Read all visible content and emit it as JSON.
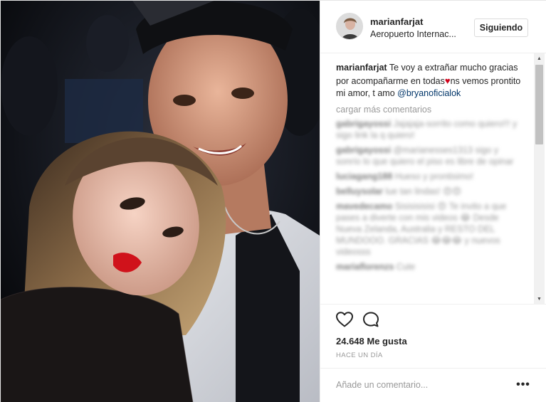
{
  "header": {
    "username": "marianfarjat",
    "location": "Aeropuerto Internac...",
    "follow_label": "Siguiendo"
  },
  "caption": {
    "user": "marianfarjat",
    "text_before": "Te voy a extrañar mucho gracias por acompañarme en todas",
    "heart": "♥",
    "text_after": "ns vemos prontito mi amor, t amo",
    "mention": "@bryanoficialok"
  },
  "load_more": "cargar más comentarios",
  "comments": [
    {
      "user": "gabrigayossi",
      "text": "Jajajaja-sorrito como quiero!!! y sigo link la q quiero!"
    },
    {
      "user": "gabrigayossi",
      "text": "@marianesses1313 sigo y sonrío lo que quiero el piso es libre de opinar"
    },
    {
      "user": "luciagang188",
      "text": "Hueso y prontisimo!"
    },
    {
      "user": "belluysolar",
      "text": "lue tan lindas! 😍😍"
    },
    {
      "user": "mavedecamo",
      "text": "Sisisisisisi 😍 Te invito a que pases a diverte con mis videos 😂 Desde Nueva Zelanda, Australia y RESTO DEL MUNDOOO. GRACIAS 😂😂😂 y nuevos videosss"
    },
    {
      "user": "mariaflorenzs",
      "text": "Cute"
    }
  ],
  "actions": {
    "likes": "24.648 Me gusta",
    "timestamp": "HACE UN DÍA"
  },
  "add_comment": {
    "placeholder": "Añade un comentario...",
    "more": "•••"
  },
  "colors": {
    "mention": "#003569",
    "heart": "#d0021b",
    "muted": "#999999",
    "border": "#efefef"
  }
}
